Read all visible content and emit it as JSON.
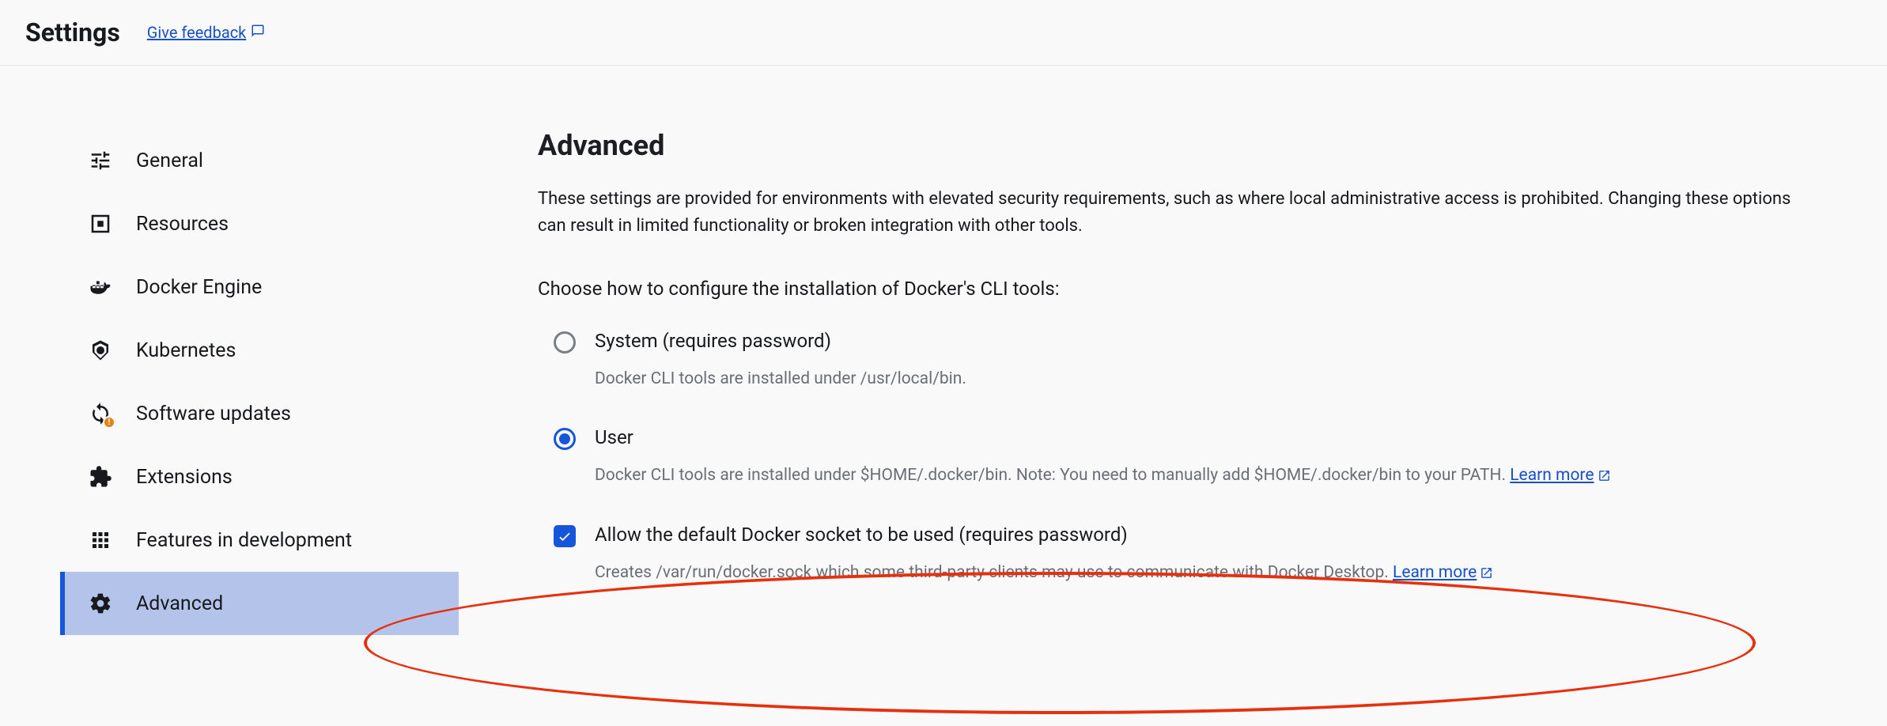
{
  "header": {
    "title": "Settings",
    "feedback": "Give feedback"
  },
  "sidebar": {
    "items": [
      {
        "label": "General"
      },
      {
        "label": "Resources"
      },
      {
        "label": "Docker Engine"
      },
      {
        "label": "Kubernetes"
      },
      {
        "label": "Software updates"
      },
      {
        "label": "Extensions"
      },
      {
        "label": "Features in development"
      },
      {
        "label": "Advanced"
      }
    ]
  },
  "main": {
    "title": "Advanced",
    "description": "These settings are provided for environments with elevated security requirements, such as where local administrative access is prohibited. Changing these options can result in limited functionality or broken integration with other tools.",
    "cli_prompt": "Choose how to configure the installation of Docker's CLI tools:",
    "options": {
      "system": {
        "label": "System (requires password)",
        "help": "Docker CLI tools are installed under /usr/local/bin."
      },
      "user": {
        "label": "User",
        "help": "Docker CLI tools are installed under $HOME/.docker/bin. Note: You need to manually add $HOME/.docker/bin to your PATH. ",
        "learn_more": "Learn more"
      }
    },
    "socket": {
      "label": "Allow the default Docker socket to be used (requires password)",
      "help": "Creates /var/run/docker.sock which some third-party clients may use to communicate with Docker Desktop. ",
      "learn_more": "Learn more"
    }
  }
}
